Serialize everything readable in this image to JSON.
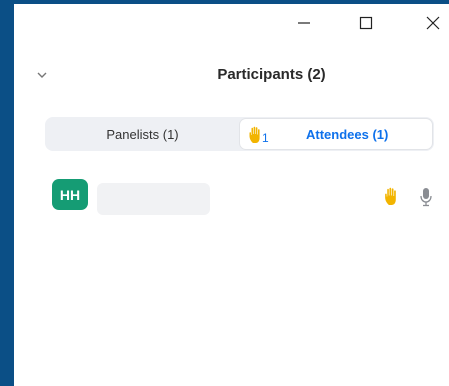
{
  "window": {
    "title": "Participants (2)"
  },
  "tabs": {
    "panelists_label": "Panelists (1)",
    "attendees_label": "Attendees (1)",
    "raised_hands_count": "1"
  },
  "participants": [
    {
      "initials": "HH",
      "avatar_color": "#159c74",
      "hand_raised": true,
      "audio": "muted"
    }
  ],
  "icons": {
    "minimize": "minimize-icon",
    "maximize": "maximize-icon",
    "close": "close-icon",
    "collapse": "chevron-down-icon",
    "hand": "raised-hand-icon",
    "mic": "microphone-icon"
  },
  "colors": {
    "background": "#0b4f86",
    "accent": "#0e71eb",
    "hand": "#f2b400"
  }
}
